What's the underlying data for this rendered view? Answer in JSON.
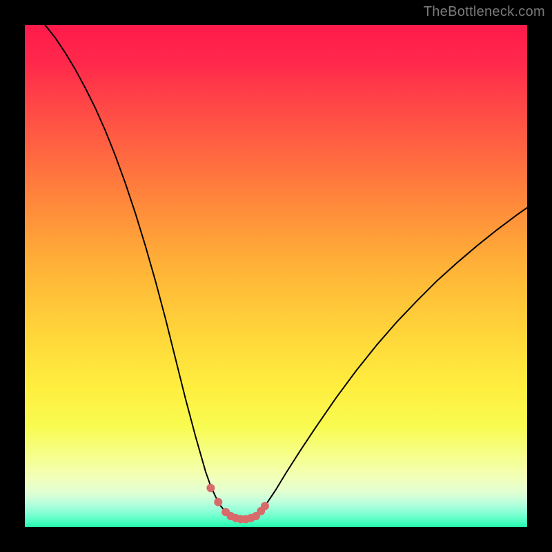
{
  "watermark": {
    "text": "TheBottleneck.com"
  },
  "colors": {
    "page_bg": "#000000",
    "curve_stroke": "#000000",
    "marker_fill": "#d86a6a",
    "gradient_top": "#ff1a4b",
    "gradient_bottom": "#20f7a8"
  },
  "chart_data": {
    "type": "line",
    "title": "",
    "xlabel": "",
    "ylabel": "",
    "xlim": [
      0,
      100
    ],
    "ylim": [
      0,
      100
    ],
    "grid": false,
    "legend": false,
    "series": [
      {
        "name": "bottleneck-curve",
        "x": [
          4,
          6,
          8,
          10,
          12,
          14,
          16,
          18,
          20,
          22,
          24,
          26,
          28,
          30,
          32,
          34,
          36,
          37,
          38,
          39,
          40,
          41,
          42,
          43,
          44,
          45,
          46,
          47,
          48,
          50,
          52,
          55,
          58,
          62,
          66,
          70,
          74,
          78,
          82,
          86,
          90,
          94,
          98,
          100
        ],
        "values": [
          100,
          97.5,
          94.5,
          91.2,
          87.5,
          83.5,
          79.0,
          74.0,
          68.5,
          62.5,
          56.0,
          49.0,
          41.5,
          33.5,
          25.5,
          18.0,
          11.0,
          8.2,
          6.0,
          4.2,
          3.0,
          2.2,
          1.8,
          1.6,
          1.6,
          1.8,
          2.2,
          3.2,
          4.5,
          7.5,
          10.8,
          15.5,
          20.0,
          25.8,
          31.2,
          36.2,
          40.8,
          45.0,
          49.0,
          52.6,
          56.0,
          59.2,
          62.2,
          63.6
        ]
      }
    ],
    "markers": {
      "name": "valley-points",
      "x": [
        37.0,
        38.5,
        40.0,
        41.0,
        42.0,
        43.0,
        44.0,
        45.0,
        46.0,
        47.0,
        47.8
      ],
      "yvalues": [
        7.8,
        5.0,
        3.0,
        2.2,
        1.8,
        1.6,
        1.6,
        1.8,
        2.2,
        3.2,
        4.2
      ],
      "radius_px": 6
    }
  }
}
